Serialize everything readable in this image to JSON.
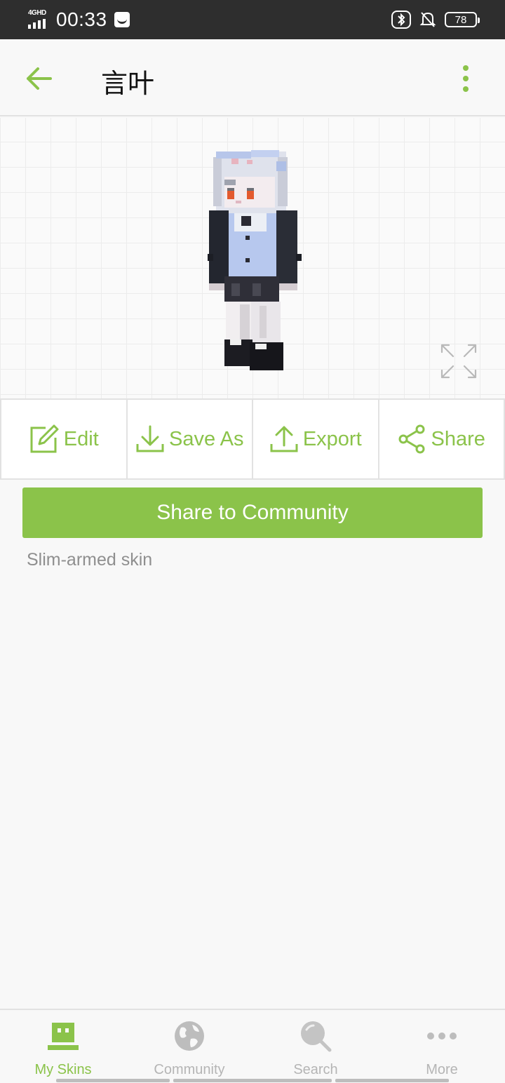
{
  "status_bar": {
    "time": "00:33",
    "network": "4GHD",
    "battery": "78"
  },
  "header": {
    "title": "言叶",
    "back_icon": "arrow-left-icon",
    "menu_icon": "more-vertical-icon"
  },
  "actions": [
    {
      "label": "Edit",
      "icon": "edit-icon"
    },
    {
      "label": "Save As",
      "icon": "download-icon"
    },
    {
      "label": "Export",
      "icon": "upload-icon"
    },
    {
      "label": "Share",
      "icon": "share-icon"
    }
  ],
  "main": {
    "share_button": "Share to Community",
    "skin_type": "Slim-armed skin"
  },
  "bottom_nav": [
    {
      "label": "My Skins",
      "icon": "robot-face-icon",
      "active": true
    },
    {
      "label": "Community",
      "icon": "globe-icon",
      "active": false
    },
    {
      "label": "Search",
      "icon": "search-icon",
      "active": false
    },
    {
      "label": "More",
      "icon": "more-horizontal-icon",
      "active": false
    }
  ],
  "colors": {
    "accent": "#8bc34a",
    "inactive": "#b5b5b5",
    "status_bar": "#2e2e2e"
  }
}
